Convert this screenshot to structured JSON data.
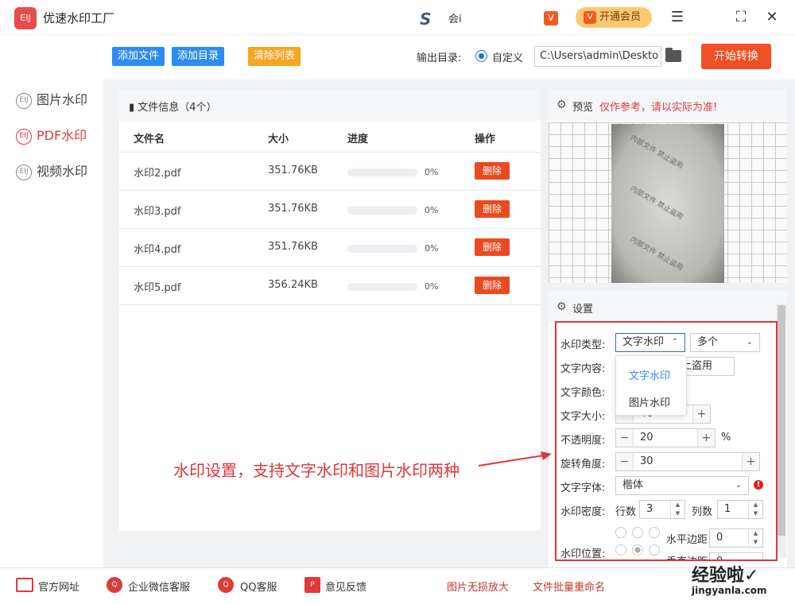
{
  "app": {
    "logo_text": "EIJ",
    "title": "优速水印工厂",
    "user_logo": "S",
    "user_name": "会i",
    "vip_small_icon": "V",
    "vip_label": "开通会员",
    "menu_icon": "☰",
    "fullscreen_icon": "⛶",
    "close_icon": "✕"
  },
  "sidebar": {
    "items": [
      {
        "label": "图片水印",
        "icon": "EIJ"
      },
      {
        "label": "PDF水印",
        "icon": "EIJ"
      },
      {
        "label": "视频水印",
        "icon": "EIJ"
      }
    ]
  },
  "toolbar": {
    "add_file": "添加文件",
    "add_dir": "添加目录",
    "clear_list": "清除列表",
    "output_label": "输出目录:",
    "radio_label": "自定义",
    "output_path": "C:\\Users\\admin\\Deskto",
    "start": "开始转换"
  },
  "files": {
    "header": "文件信息（4个）",
    "columns": [
      "文件名",
      "大小",
      "进度",
      "操作"
    ],
    "rows": [
      {
        "name": "水印2.pdf",
        "size": "351.76KB",
        "progress": "0%",
        "action": "删除"
      },
      {
        "name": "水印3.pdf",
        "size": "351.76KB",
        "progress": "0%",
        "action": "删除"
      },
      {
        "name": "水印4.pdf",
        "size": "351.76KB",
        "progress": "0%",
        "action": "删除"
      },
      {
        "name": "水印5.pdf",
        "size": "356.24KB",
        "progress": "0%",
        "action": "删除"
      }
    ]
  },
  "preview": {
    "label": "预览",
    "note": "仅作参考，请以实际为准!",
    "watermark_text": "内部文件 禁止盗用"
  },
  "settings": {
    "label": "设置",
    "type_label": "水印类型:",
    "type_value": "文字水印",
    "count_value": "多个",
    "content_label": "文字内容:",
    "content_value": "上盗用",
    "color_label": "文字颜色:",
    "size_label": "文字大小:",
    "size_value": "40",
    "opacity_label": "不透明度:",
    "opacity_value": "20",
    "opacity_unit": "%",
    "rotation_label": "旋转角度:",
    "rotation_value": "30",
    "font_label": "文字字体:",
    "font_value": "楷体",
    "density_label": "水印密度:",
    "rows_label": "行数",
    "rows_value": "3",
    "cols_label": "列数",
    "cols_value": "1",
    "position_label": "水印位置:",
    "h_margin_label": "水平边距",
    "h_margin_value": "0",
    "v_margin_label": "垂直边距",
    "v_margin_value": "0",
    "dropdown_options": [
      "文字水印",
      "图片水印"
    ],
    "plus": "+",
    "minus": "−",
    "alert": "!"
  },
  "annotation": "水印设置，支持文字水印和图片水印两种",
  "bottom": {
    "items": [
      "官方网址",
      "企业微信客服",
      "QQ客服",
      "意见反馈"
    ],
    "right_items": [
      "图片无损放大",
      "文件批量重命名"
    ]
  },
  "site_watermark": {
    "logo": "经验啦✓",
    "url": "jingyanla.com"
  },
  "colors": {
    "accent_red": "#e03a3a",
    "blue_button": "#2d8cf0",
    "orange_button": "#f5a623",
    "start_button": "#f04e23"
  }
}
